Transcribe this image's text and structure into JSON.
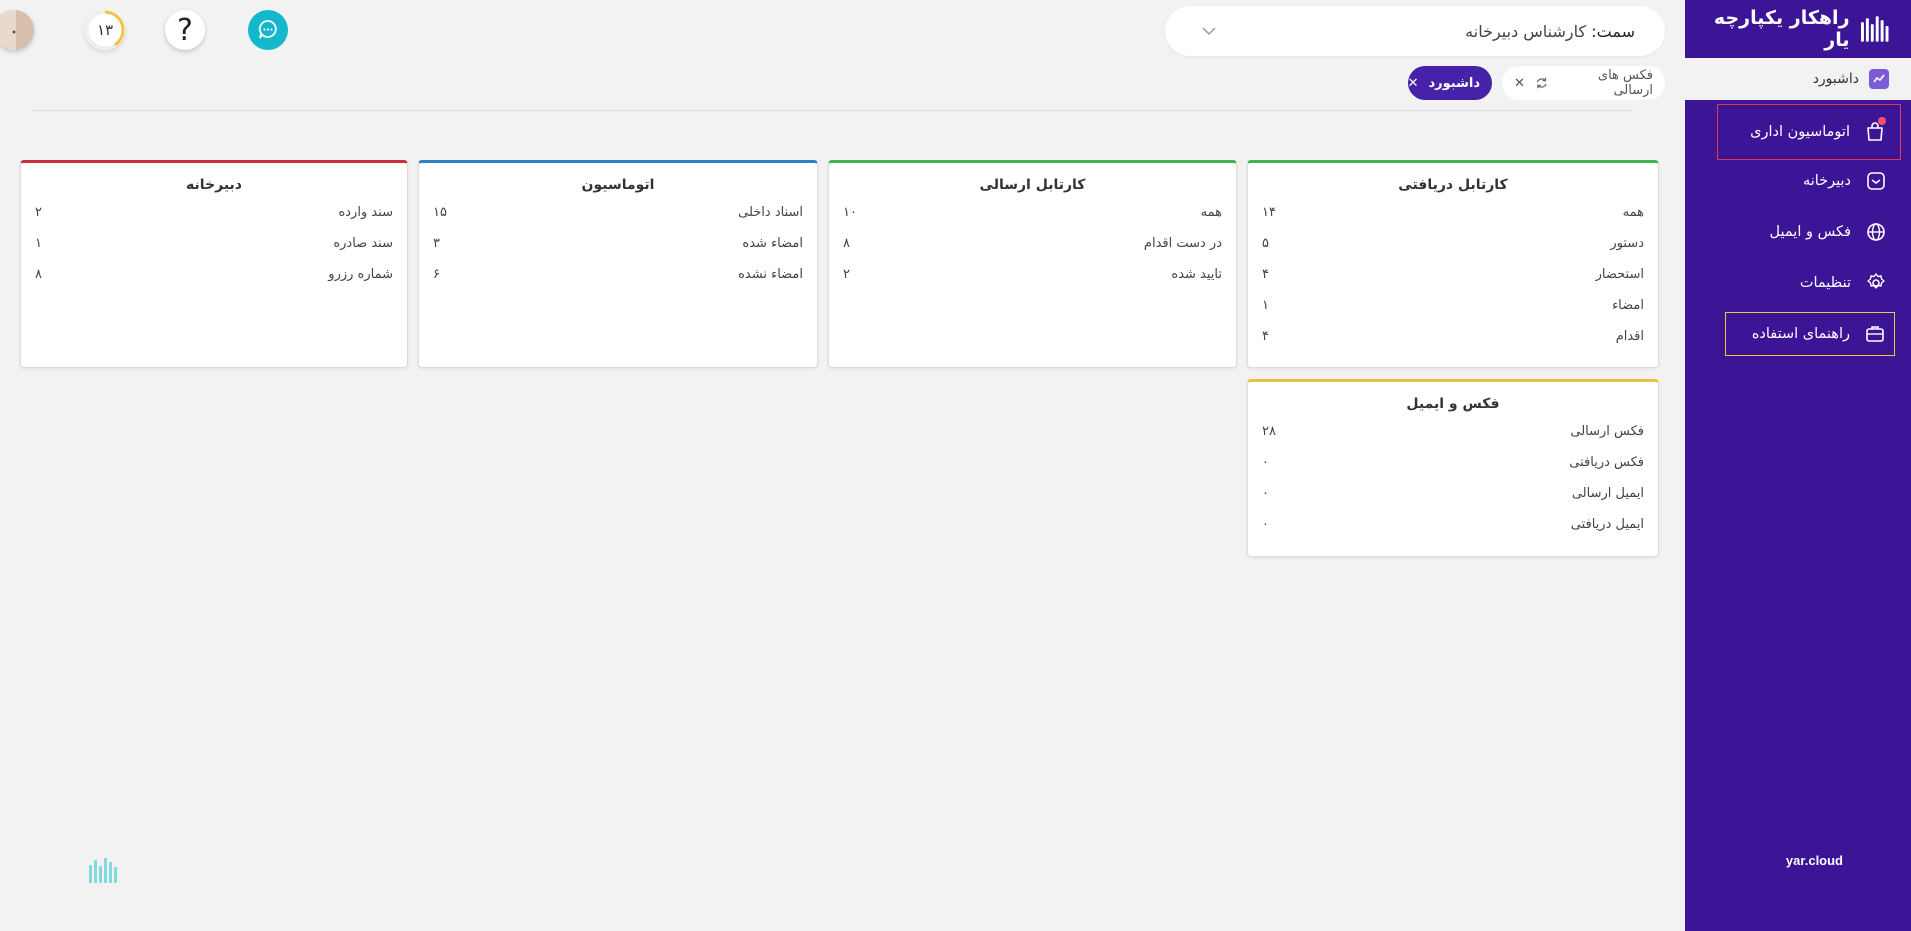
{
  "brand": {
    "title": "راهکار یکپارچه یار"
  },
  "sidebar": {
    "dashboard_label": "داشبورد",
    "items": [
      {
        "label": "اتوماسیون اداری",
        "icon": "bag-icon"
      },
      {
        "label": "دبیرخانه",
        "icon": "inbox-icon"
      },
      {
        "label": "فکس و ایمیل",
        "icon": "globe-icon"
      },
      {
        "label": "تنظیمات",
        "icon": "gear-icon"
      },
      {
        "label": "راهنمای استفاده",
        "icon": "briefcase-icon"
      }
    ],
    "footer": "yar.cloud"
  },
  "header": {
    "role_label": "سمت:",
    "role_value": "کارشناس دبیرخانه",
    "help_glyph": "?",
    "counter": "۱۳"
  },
  "tabs": [
    {
      "label": "فکس های ارسالی",
      "close": "✕"
    },
    {
      "label": "داشبورد",
      "close": "✕"
    }
  ],
  "cards": {
    "received": {
      "title": "کارتابل دریافتی",
      "rows": [
        {
          "label": "همه",
          "value": "۱۴"
        },
        {
          "label": "دستور",
          "value": "۵"
        },
        {
          "label": "استحضار",
          "value": "۴"
        },
        {
          "label": "امضاء",
          "value": "۱"
        },
        {
          "label": "اقدام",
          "value": "۴"
        }
      ]
    },
    "sent": {
      "title": "کارتابل ارسالی",
      "rows": [
        {
          "label": "همه",
          "value": "۱۰"
        },
        {
          "label": "در دست اقدام",
          "value": "۸"
        },
        {
          "label": "تایید شده",
          "value": "۲"
        }
      ]
    },
    "automation": {
      "title": "اتوماسیون",
      "rows": [
        {
          "label": "اسناد داخلی",
          "value": "۱۵"
        },
        {
          "label": "امضاء شده",
          "value": "۳"
        },
        {
          "label": "امضاء نشده",
          "value": "۶"
        }
      ]
    },
    "secretariat": {
      "title": "دبیرخانه",
      "rows": [
        {
          "label": "سند وارده",
          "value": "۲"
        },
        {
          "label": "سند صادره",
          "value": "۱"
        },
        {
          "label": "شماره رزرو",
          "value": "۸"
        }
      ]
    },
    "fax_email": {
      "title": "فکس و ایمیل",
      "rows": [
        {
          "label": "فکس ارسالی",
          "value": "۲۸"
        },
        {
          "label": "فکس دریافتی",
          "value": "۰"
        },
        {
          "label": "ایمیل ارسالی",
          "value": "۰"
        },
        {
          "label": "ایمیل دریافتی",
          "value": "۰"
        }
      ]
    }
  },
  "colors": {
    "sidebar": "#3c1496",
    "active_tab": "#4522a8",
    "received_border": "#3cb653",
    "automation_border": "#2b7fc9",
    "secretariat_border": "#c83040",
    "fax_border": "#e8c23a",
    "chat_button": "#14b8cc"
  }
}
